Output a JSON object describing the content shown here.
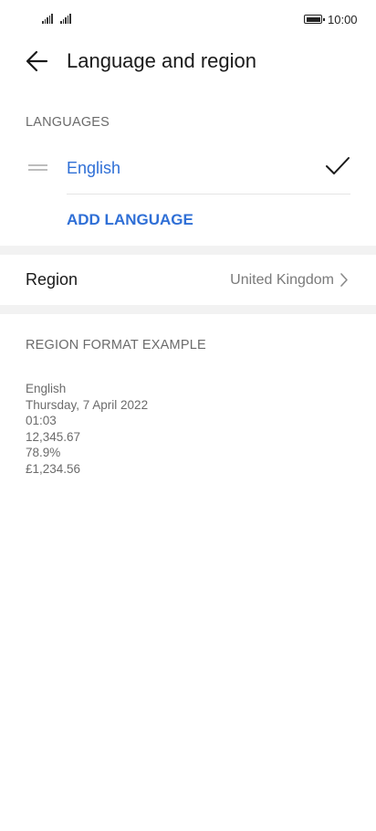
{
  "status_bar": {
    "time": "10:00"
  },
  "header": {
    "title": "Language and region"
  },
  "languages": {
    "section_title": "LANGUAGES",
    "items": [
      {
        "label": "English",
        "selected": true
      }
    ],
    "add_label": "ADD LANGUAGE"
  },
  "region": {
    "label": "Region",
    "value": "United Kingdom"
  },
  "format_example": {
    "section_title": "REGION FORMAT EXAMPLE",
    "language": "English",
    "date": "Thursday, 7 April 2022",
    "time": "01:03",
    "number": "12,345.67",
    "percent": "78.9%",
    "currency": "£1,234.56"
  },
  "icons": {
    "back": "arrow-left-icon",
    "drag": "drag-handle-icon",
    "check": "check-icon",
    "chevron": "chevron-right-icon"
  },
  "colors": {
    "accent": "#2f6fd6",
    "secondary_text": "#6b6b6b",
    "band": "#f2f2f2"
  }
}
